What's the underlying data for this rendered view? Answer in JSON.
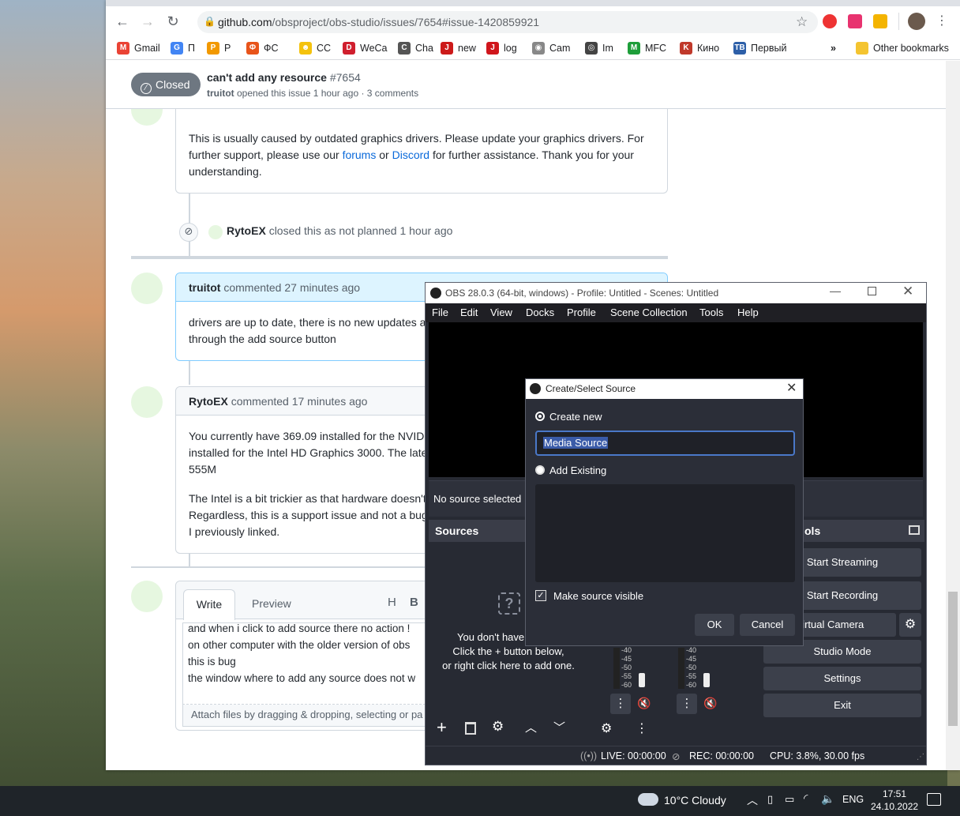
{
  "browser": {
    "url_domain": "github.com",
    "url_path": "/obsproject/obs-studio/issues/7654#issue-1420859921",
    "bookmarks": [
      {
        "label": "Gmail",
        "icon": "gmail-icon",
        "color": "#ea4335",
        "glyph": "M"
      },
      {
        "label": "П",
        "icon": "translate-icon",
        "color": "#4285f4",
        "glyph": "G"
      },
      {
        "label": "Р",
        "icon": "p-icon",
        "color": "#f29900",
        "glyph": "P"
      },
      {
        "label": "ФС",
        "icon": "fs-icon",
        "color": "#e8541a",
        "glyph": "Φ"
      },
      {
        "label": "СС",
        "icon": "smile-icon",
        "color": "#f4c20d",
        "glyph": "☻"
      },
      {
        "label": "WeCa",
        "icon": "dirty-icon",
        "color": "#d01f2e",
        "glyph": "D"
      },
      {
        "label": "Cha",
        "icon": "cha-icon",
        "color": "#555",
        "glyph": "C"
      },
      {
        "label": "new",
        "icon": "j-icon",
        "color": "#cc1a1a",
        "glyph": "J"
      },
      {
        "label": "log",
        "icon": "j-icon",
        "color": "#d0161c",
        "glyph": "J"
      },
      {
        "label": "Cam",
        "icon": "cam-icon",
        "color": "#888",
        "glyph": "◉"
      },
      {
        "label": "Im",
        "icon": "im-icon",
        "color": "#444",
        "glyph": "◎"
      },
      {
        "label": "MFC",
        "icon": "m-icon",
        "color": "#1e9e3a",
        "glyph": "M"
      },
      {
        "label": "Кино",
        "icon": "kino-icon",
        "color": "#c0392b",
        "glyph": "K"
      },
      {
        "label": "Первый",
        "icon": "tv-icon",
        "color": "#2d5fa8",
        "glyph": "ТВ"
      }
    ],
    "more": "»",
    "other_bookmarks": "Other bookmarks"
  },
  "issue": {
    "state": "Closed",
    "title": "can't add any resource",
    "number": "#7654",
    "author": "truitot",
    "meta": "opened this issue 1 hour ago · 3 comments"
  },
  "comment1": {
    "text_a": "This is usually caused by outdated graphics drivers. Please update your graphics drivers. For",
    "text_b_pre": "further support, please use our ",
    "link1": "forums",
    "or": " or ",
    "link2": "Discord",
    "text_b_post": " for further assistance. Thank you for your",
    "text_c": "understanding."
  },
  "event": {
    "user": "RytoEX",
    "action": "closed this as not planned 1 hour ago"
  },
  "comment2": {
    "user": "truitot",
    "time": "commented 27 minutes ago",
    "line1": "drivers are up to date, there is no new updates a",
    "line2": "through the add source button"
  },
  "comment3": {
    "user": "RytoEX",
    "time": "commented 17 minutes ago",
    "line1": "You currently have 369.09 installed for the NVIDI",
    "line2": "installed for the Intel HD Graphics 3000. The late",
    "line3": "555M",
    "line4": "The Intel is a bit trickier as that hardware doesn't",
    "line5": "Regardless, this is a support issue and not a bug",
    "line6": "I previously linked."
  },
  "editor": {
    "tab_write": "Write",
    "tab_preview": "Preview",
    "line1": "and when i click to add source there no action !",
    "line2": "on other computer with the older version of obs",
    "line3": "this is bug",
    "line4": "the window where to add any source does not w",
    "attach": "Attach files by dragging & dropping, selecting or pa"
  },
  "obs": {
    "title": "OBS 28.0.3 (64-bit, windows) - Profile: Untitled - Scenes: Untitled",
    "menu": [
      "File",
      "Edit",
      "View",
      "Docks",
      "Profile",
      "Scene Collection",
      "Tools",
      "Help"
    ],
    "no_source": "No source selected",
    "sources": "Sources",
    "controls": "ols",
    "empty1": "You don't have ar",
    "empty2": "Click the + button below,",
    "empty3": "or right click here to add one.",
    "start_streaming": "Start Streaming",
    "start_recording": "Start Recording",
    "virtual_camera": "Virtual Camera",
    "studio_mode": "Studio Mode",
    "settings": "Settings",
    "exit": "Exit",
    "meter_ticks": [
      "-40",
      "-45",
      "-50",
      "-55",
      "-60"
    ],
    "live": "LIVE: 00:00:00",
    "rec": "REC: 00:00:00",
    "cpu": "CPU: 3.8%, 30.00 fps"
  },
  "dialog": {
    "title": "Create/Select Source",
    "create_new": "Create new",
    "name_value": "Media Source",
    "add_existing": "Add Existing",
    "make_visible": "Make source visible",
    "ok": "OK",
    "cancel": "Cancel"
  },
  "taskbar": {
    "weather": "10°C  Cloudy",
    "lang": "ENG",
    "time": "17:51",
    "date": "24.10.2022"
  }
}
